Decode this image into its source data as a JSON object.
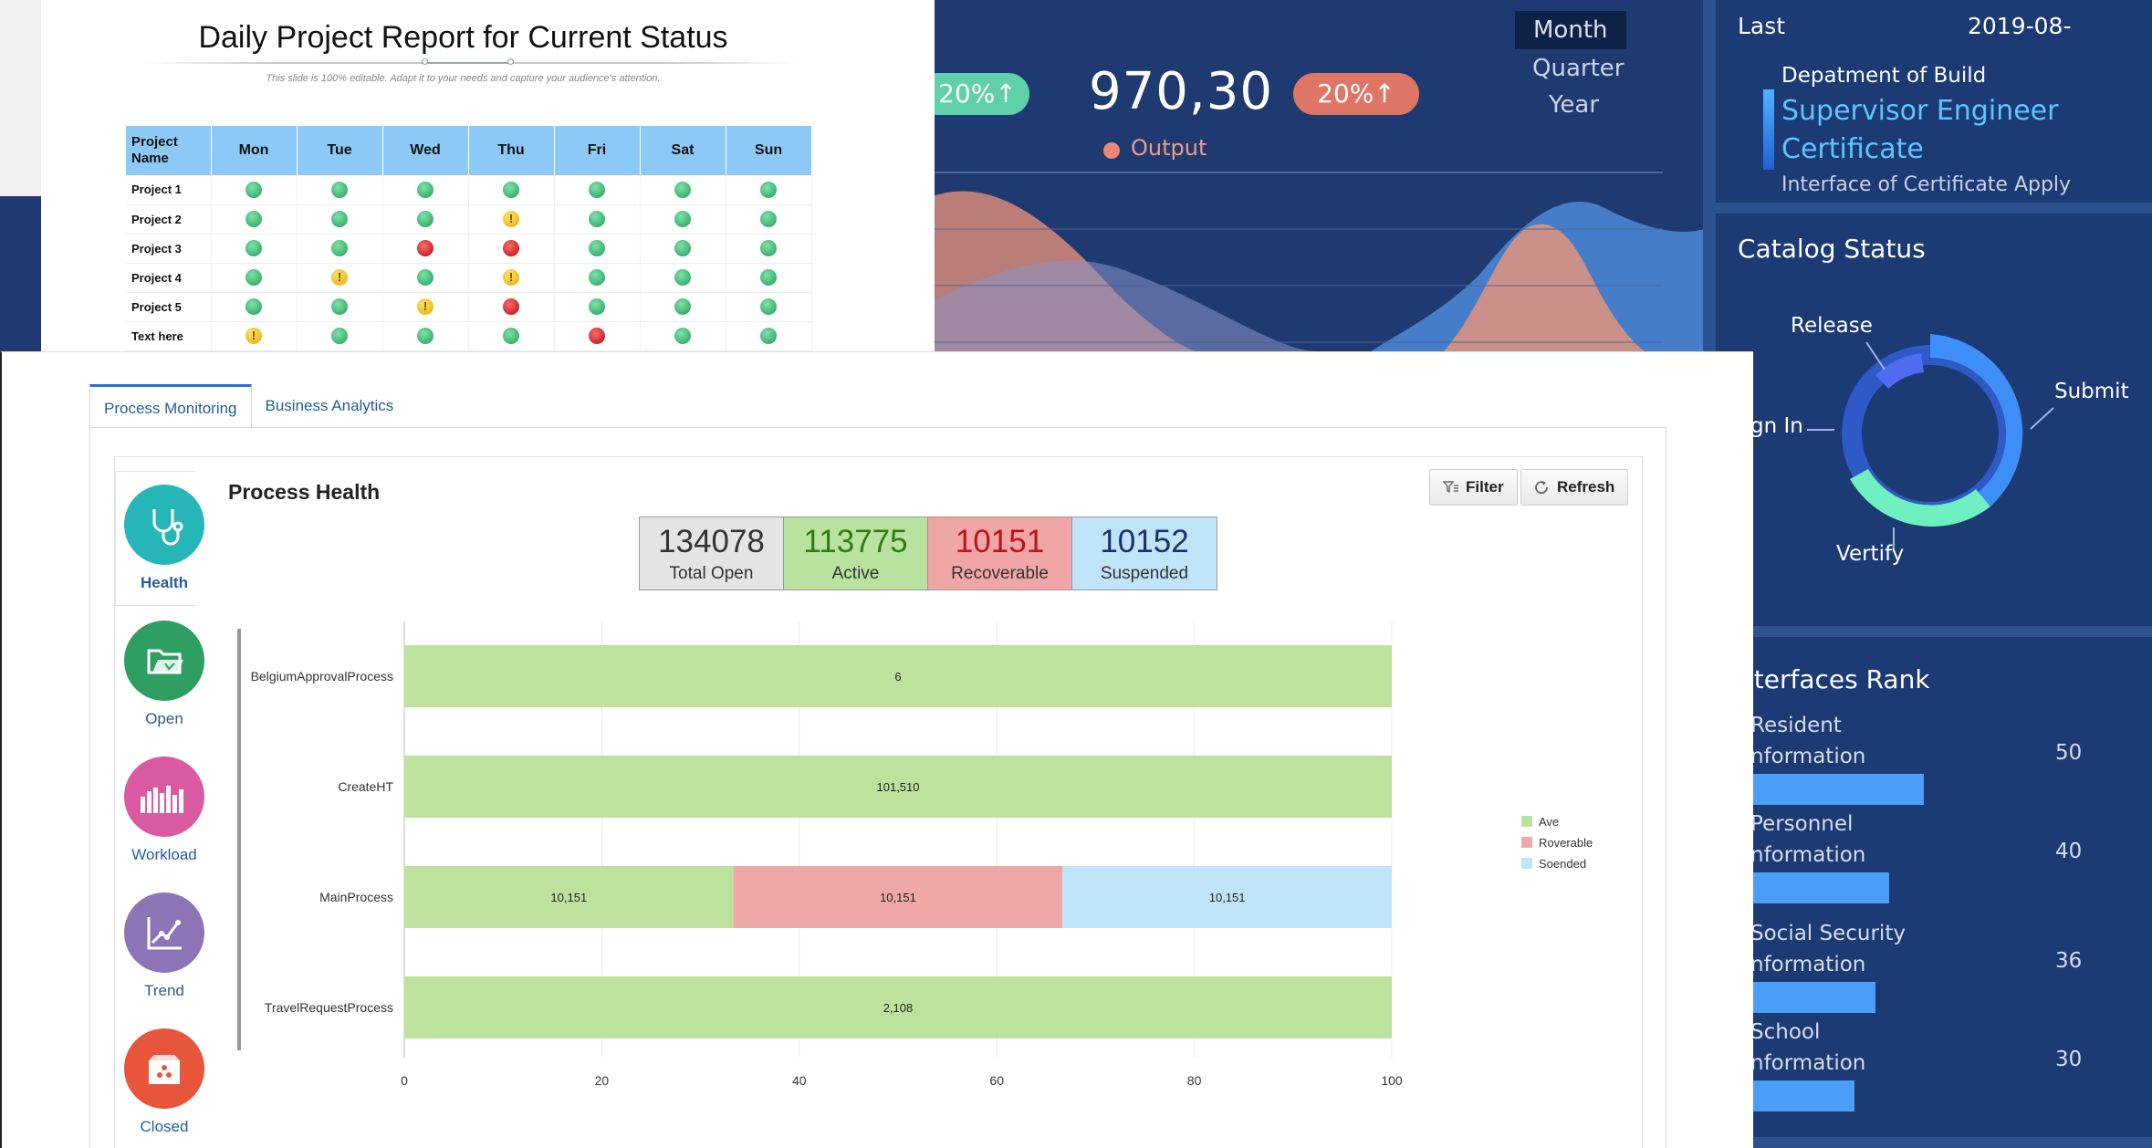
{
  "dashboard": {
    "kpi": {
      "value": "970,30",
      "left_pill": "20%↑",
      "right_pill": "20%↑",
      "legend": "Output"
    },
    "periods": [
      "Month",
      "Quarter",
      "Year"
    ],
    "selected_period": "Month",
    "last_label": "Last",
    "last_value": "2019-08-",
    "department": "Depatment of Build",
    "supervisor": [
      "Supervisor Engineer",
      "Certificate"
    ],
    "interface_apply": "Interface of Certificate Apply",
    "catalog_title": "Catalog Status",
    "catalog_labels": {
      "release": "Release",
      "submit": "Submit",
      "sign_in": "gn In",
      "verify": "Vertify"
    },
    "rank_title": "nterfaces Rank",
    "rank": [
      {
        "label1": "Resident",
        "label2": "nformation",
        "value": "50",
        "share": 0.5
      },
      {
        "label1": "Personnel",
        "label2": "nformation",
        "value": "40",
        "share": 0.4
      },
      {
        "label1": "Social Security",
        "label2": "nformation",
        "value": "36",
        "share": 0.36
      },
      {
        "label1": "School",
        "label2": "nformation",
        "value": "30",
        "share": 0.3
      }
    ],
    "colors": {
      "bg": "#1f3a70",
      "accent": "#4a9ef7",
      "green_pill": "#5fd0a9",
      "red_pill": "#df7565"
    }
  },
  "report": {
    "title": "Daily Project Report for Current Status",
    "subtitle": "This slide is 100% editable. Adapt it to your needs and capture your audience's attention.",
    "header_project": "Project Name",
    "days": [
      "Mon",
      "Tue",
      "Wed",
      "Thu",
      "Fri",
      "Sat",
      "Sun"
    ],
    "rows": [
      {
        "name": "Project 1",
        "status": [
          "g",
          "g",
          "g",
          "g",
          "g",
          "g",
          "g"
        ]
      },
      {
        "name": "Project 2",
        "status": [
          "g",
          "g",
          "g",
          "y",
          "g",
          "g",
          "g"
        ]
      },
      {
        "name": "Project 3",
        "status": [
          "g",
          "g",
          "r",
          "r",
          "g",
          "g",
          "g"
        ]
      },
      {
        "name": "Project 4",
        "status": [
          "g",
          "y",
          "g",
          "y",
          "g",
          "g",
          "g"
        ]
      },
      {
        "name": "Project 5",
        "status": [
          "g",
          "g",
          "y",
          "r",
          "g",
          "g",
          "g"
        ]
      },
      {
        "name": "Text here",
        "status": [
          "y",
          "g",
          "g",
          "g",
          "r",
          "g",
          "g"
        ]
      }
    ],
    "status_legend": {
      "g": "green-status-icon",
      "y": "warning-status-icon",
      "r": "red-status-icon"
    }
  },
  "app": {
    "tabs": [
      "Process Monitoring",
      "Business Analytics"
    ],
    "active_tab": "Process Monitoring",
    "nav": [
      {
        "label": "Health",
        "icon": "stethoscope-icon",
        "color": "#27b6b8"
      },
      {
        "label": "Open",
        "icon": "open-folder-icon",
        "color": "#2f9e62"
      },
      {
        "label": "Workload",
        "icon": "workload-bars-icon",
        "color": "#d95aa1"
      },
      {
        "label": "Trend",
        "icon": "trend-chart-icon",
        "color": "#8d74b6"
      },
      {
        "label": "Closed",
        "icon": "closed-box-icon",
        "color": "#e7553a"
      }
    ],
    "title": "Process Health",
    "filter_label": "Filter",
    "refresh_label": "Refresh",
    "tiles": [
      {
        "value": "134078",
        "label": "Total Open"
      },
      {
        "value": "113775",
        "label": "Active"
      },
      {
        "value": "10151",
        "label": "Recoverable"
      },
      {
        "value": "10152",
        "label": "Suspended"
      }
    ]
  },
  "chart_data": {
    "type": "bar",
    "orientation": "horizontal",
    "stacked": true,
    "percent": true,
    "categories": [
      "BelgiumApprovalProcess",
      "CreateHT",
      "MainProcess",
      "TravelRequestProcess"
    ],
    "series": [
      {
        "name": "Ave",
        "color": "#bde29e",
        "values": [
          100,
          100,
          33.33,
          100
        ],
        "labels": [
          "6",
          "101,510",
          "10,151",
          "2,108"
        ]
      },
      {
        "name": "Roverable",
        "color": "#efa7a7",
        "values": [
          0,
          0,
          33.33,
          0
        ],
        "labels": [
          "",
          "",
          "10,151",
          ""
        ]
      },
      {
        "name": "Soended",
        "color": "#bfe4f7",
        "values": [
          0,
          0,
          33.34,
          0
        ],
        "labels": [
          "",
          "",
          "10,151",
          ""
        ]
      }
    ],
    "xticks": [
      "0",
      "20",
      "40",
      "60",
      "80",
      "100"
    ],
    "xlim": [
      0,
      100
    ],
    "grid": true,
    "legend_position": "right"
  }
}
